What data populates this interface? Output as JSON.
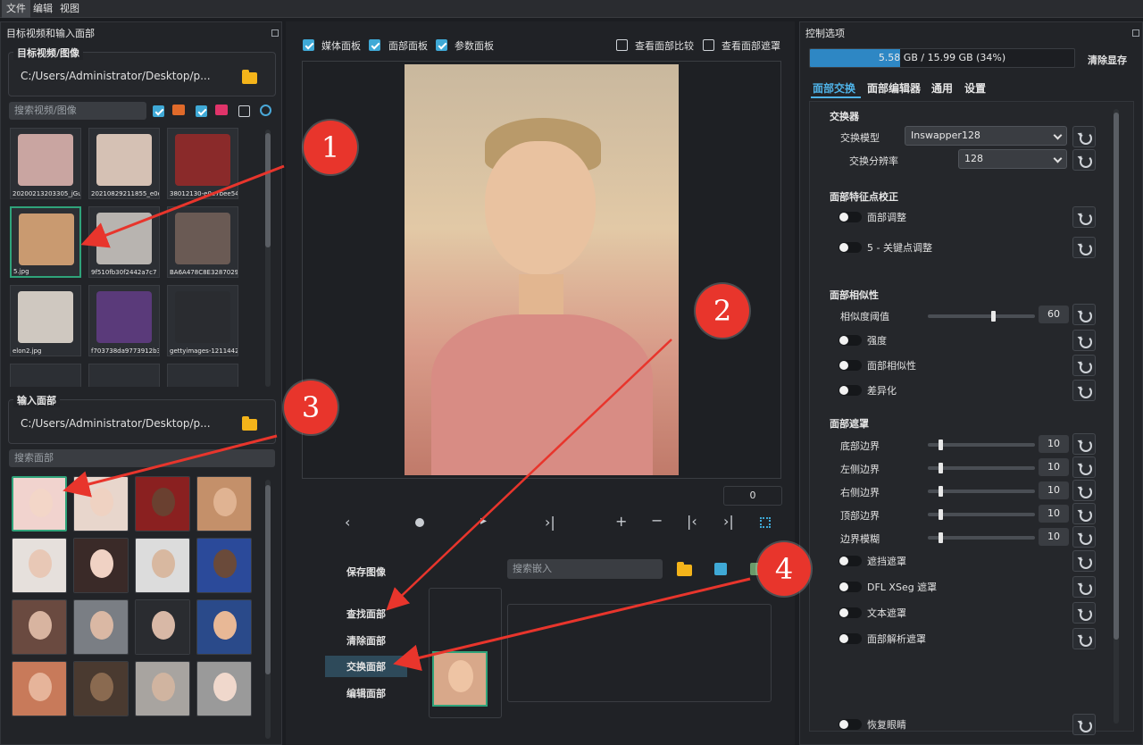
{
  "menu": {
    "items": [
      "文件",
      "编辑",
      "视图"
    ]
  },
  "left_panel": {
    "title": "目标视频和输入面部",
    "target_group": {
      "title": "目标视频/图像",
      "path": "C:/Users/Administrator/Desktop/p..."
    },
    "target_search_placeholder": "搜索视频/图像",
    "target_thumbs": [
      {
        "caption": "20200213203305_jGu",
        "color": "#c9a5a1"
      },
      {
        "caption": "20210829211855_e0e",
        "color": "#d5c1b4"
      },
      {
        "caption": "38012130-e0e7bee54",
        "color": "#8a2a2a"
      },
      {
        "caption": "5.jpg",
        "color": "#c99a70"
      },
      {
        "caption": "9f510fb30f2442a7c7",
        "color": "#b8b4b0"
      },
      {
        "caption": "BA6A478C8E3287029",
        "color": "#6a5a54"
      },
      {
        "caption": "elon2.jpg",
        "color": "#cfc8c0"
      },
      {
        "caption": "f703738da9773912b3",
        "color": "#5a3a7a"
      },
      {
        "caption": "gettyimages-1211442",
        "color": "#2a2c30"
      }
    ],
    "input_group": {
      "title": "输入面部",
      "path": "C:/Users/Administrator/Desktop/p..."
    },
    "face_search_placeholder": "搜索面部",
    "faces": [
      {
        "color": "#f1d3ce",
        "skin": "#f3d6c8"
      },
      {
        "color": "#e8d6cc",
        "skin": "#efd2c2"
      },
      {
        "color": "#8a2020",
        "skin": "#6a4030"
      },
      {
        "color": "#c4906a",
        "skin": "#e0b392"
      },
      {
        "color": "#e6e0dc",
        "skin": "#e8c8b6"
      },
      {
        "color": "#3a2a28",
        "skin": "#f0d2c4"
      },
      {
        "color": "#dcdcdc",
        "skin": "#d8b8a0"
      },
      {
        "color": "#2b4a9a",
        "skin": "#6a4a3a"
      },
      {
        "color": "#6a4a40",
        "skin": "#d8b4a0"
      },
      {
        "color": "#7a7e84",
        "skin": "#dab8a4"
      },
      {
        "color": "#2a2c30",
        "skin": "#d8b8a6"
      },
      {
        "color": "#2a4a8a",
        "skin": "#e8b896"
      },
      {
        "color": "#c87a5a",
        "skin": "#e6b49a"
      },
      {
        "color": "#4a3a30",
        "skin": "#8a6a50"
      },
      {
        "color": "#a8a4a0",
        "skin": "#d0b4a0"
      },
      {
        "color": "#9a9a9a",
        "skin": "#f0d8cc"
      }
    ]
  },
  "center": {
    "checks": [
      {
        "label": "媒体面板",
        "on": true
      },
      {
        "label": "面部面板",
        "on": true
      },
      {
        "label": "参数面板",
        "on": true
      },
      {
        "label": "查看面部比较",
        "on": false
      },
      {
        "label": "查看面部遮罩",
        "on": false
      }
    ],
    "frame_number": "0",
    "save_image": "保存图像",
    "embed_search_placeholder": "搜索嵌入",
    "actions": {
      "find_faces": "查找面部",
      "clear_faces": "清除面部",
      "swap_faces": "交换面部",
      "edit_faces": "编辑面部"
    }
  },
  "right_panel": {
    "title": "控制选项",
    "memory": {
      "text": "5.58 GB / 15.99 GB (34%)",
      "percent": 34
    },
    "clear_vram": "清除显存",
    "tabs": [
      "面部交换",
      "面部编辑器",
      "通用",
      "设置"
    ],
    "swapper": {
      "title": "交换器",
      "model_label": "交换模型",
      "model_value": "Inswapper128",
      "resolution_label": "交换分辨率",
      "resolution_value": "128"
    },
    "landmarks": {
      "title": "面部特征点校正",
      "face_adjust": "面部调整",
      "five_point": "5 - 关键点调整"
    },
    "similarity": {
      "title": "面部相似性",
      "threshold_label": "相似度阈值",
      "threshold_value": "60",
      "threshold_fraction": 0.6,
      "strength": "强度",
      "face_similarity": "面部相似性",
      "differ": "差异化"
    },
    "mask": {
      "title": "面部遮罩",
      "sliders": [
        {
          "label": "底部边界",
          "value": "10"
        },
        {
          "label": "左侧边界",
          "value": "10"
        },
        {
          "label": "右侧边界",
          "value": "10"
        },
        {
          "label": "顶部边界",
          "value": "10"
        },
        {
          "label": "边界模糊",
          "value": "10"
        }
      ],
      "toggles": [
        "遮挡遮罩",
        "DFL XSeg 遮罩",
        "文本遮罩",
        "面部解析遮罩"
      ]
    },
    "restore_eyes": "恢复眼睛"
  },
  "annotations": [
    "1",
    "2",
    "3",
    "4"
  ],
  "colors": {
    "accent": "#3fa9d6",
    "selection": "#2fa37a",
    "badge": "#e8352c",
    "arrow": "#e8352c"
  }
}
